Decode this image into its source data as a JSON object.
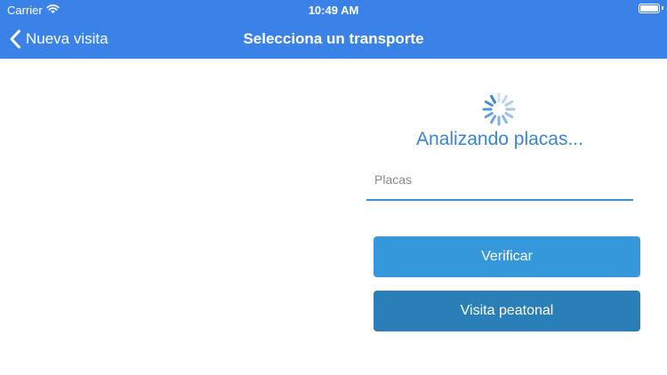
{
  "status_bar": {
    "carrier": "Carrier",
    "time": "10:49 AM",
    "wifi_icon": "wifi-icon",
    "battery_icon": "battery-icon"
  },
  "nav": {
    "back_label": "Nueva visita",
    "back_icon": "chevron-left-icon",
    "title": "Selecciona un transporte"
  },
  "main": {
    "spinner_icon": "spinner-icon",
    "status_text": "Analizando placas...",
    "plates_placeholder": "Placas",
    "plates_value": "",
    "verify_label": "Verificar",
    "walk_visit_label": "Visita peatonal"
  },
  "colors": {
    "header_bg": "#3a82e8",
    "accent_text": "#3a86d4",
    "verify_button": "#3498db",
    "walk_button": "#2a7fb8"
  }
}
